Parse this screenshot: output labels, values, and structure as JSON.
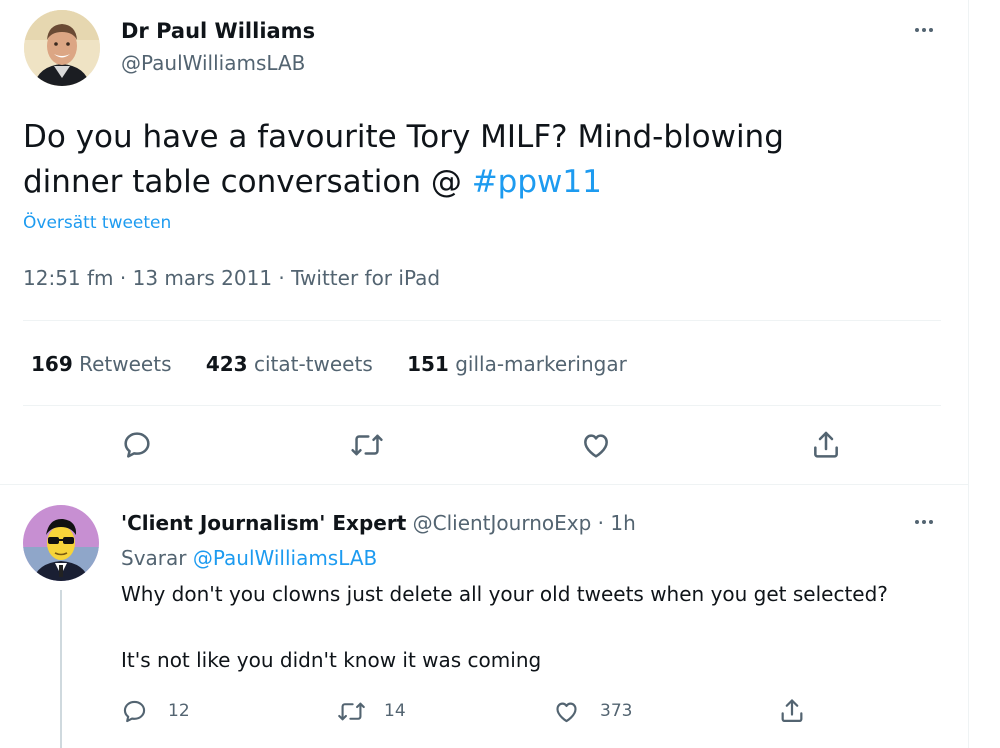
{
  "main_tweet": {
    "author_name": "Dr Paul Williams",
    "author_handle": "@PaulWilliamsLAB",
    "text": "Do you have a favourite Tory MILF? Mind-blowing dinner table conversation @",
    "hashtag": "#ppw11",
    "translate_label": "Översätt tweeten",
    "time": "12:51 fm",
    "separator": "·",
    "date": "13 mars 2011",
    "source": "Twitter for iPad",
    "stats": {
      "retweets_count": "169",
      "retweets_label": "Retweets",
      "quotes_count": "423",
      "quotes_label": "citat-tweets",
      "likes_count": "151",
      "likes_label": "gilla-markeringar"
    }
  },
  "reply": {
    "author_name": "'Client Journalism' Expert",
    "author_handle": "@ClientJournoExp",
    "separator": "·",
    "time": "1h",
    "replying_label": "Svarar",
    "replying_to": "@PaulWilliamsLAB",
    "text_line1": "Why don't you clowns just delete all your old tweets when you get selected?",
    "text_line2": "It's not like you didn't know it was coming",
    "reply_count": "12",
    "retweet_count": "14",
    "like_count": "373"
  },
  "colors": {
    "accent": "#1d9bf0",
    "text": "#0f1419",
    "muted": "#536471",
    "border": "#eff3f4"
  },
  "icons": [
    "more-icon",
    "reply-icon",
    "retweet-icon",
    "like-icon",
    "share-icon"
  ]
}
